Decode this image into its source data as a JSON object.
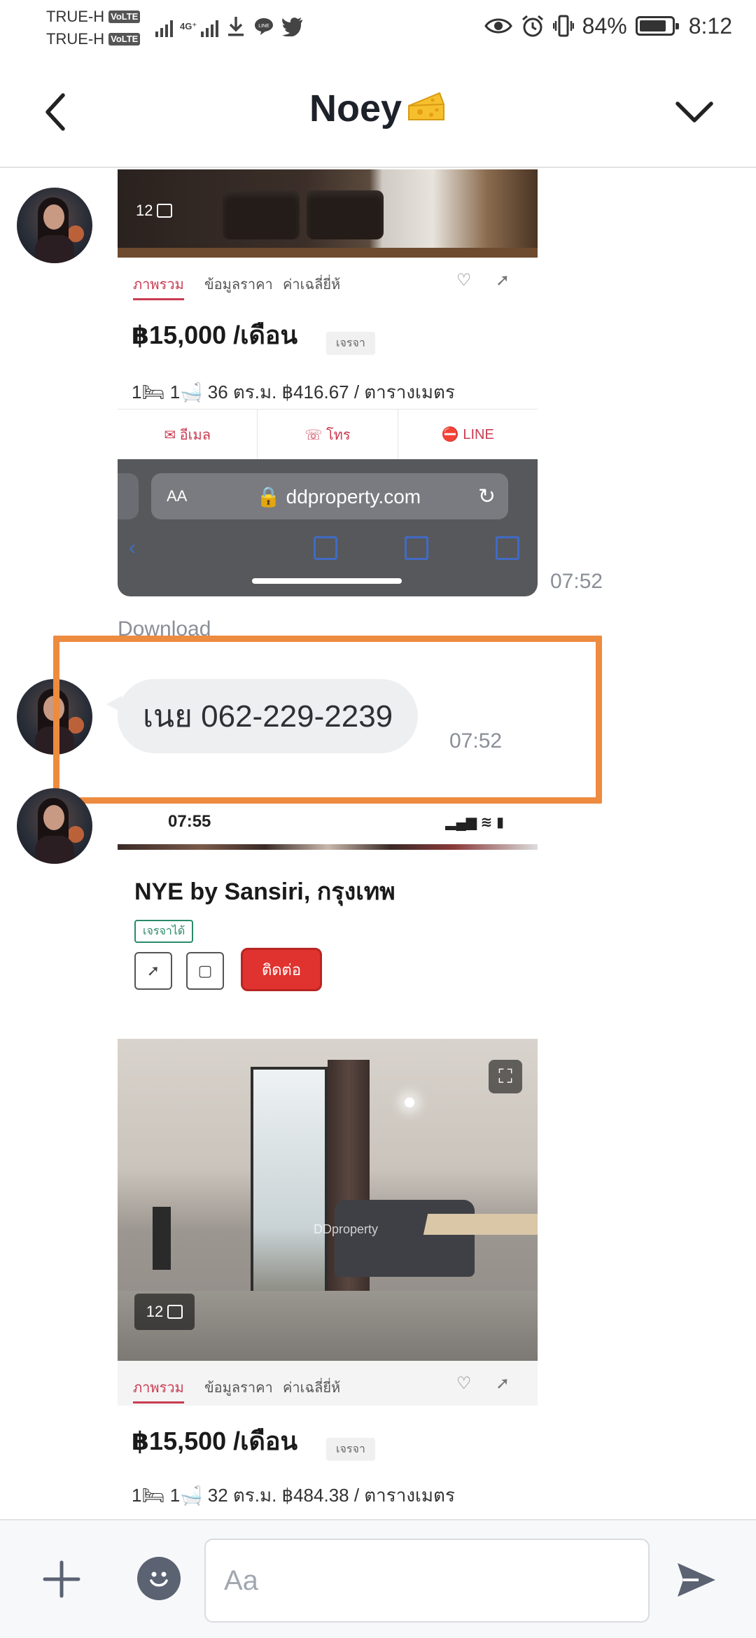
{
  "status_bar": {
    "carrier1": "TRUE-H",
    "carrier2": "TRUE-H",
    "volte_label": "VoLTE",
    "network_label": "4G⁺",
    "battery_percent": "84%",
    "battery_level": 0.84,
    "time": "8:12",
    "icons": [
      "signal-icon",
      "download-icon",
      "line-icon",
      "twitter-icon",
      "eye-icon",
      "alarm-icon",
      "vibrate-icon",
      "battery-icon"
    ]
  },
  "header": {
    "title": "Noey",
    "title_emoji": "🧀",
    "back_icon": "chevron-left-icon",
    "menu_icon": "chevron-down-icon"
  },
  "messages": {
    "image1": {
      "photo_count": "12",
      "tabs": [
        "ภาพรวม",
        "ข้อมูลราคา",
        "ค่าเฉลี่ยี่ห้"
      ],
      "price": "฿15,000 /เดือน",
      "price_tag": "เจรจา",
      "specs": "1🛏  1🛁  36 ตร.ม.  ฿416.67 / ตารางเมตร",
      "actions": [
        "✉ อีเมล",
        "☏ โทร",
        "⛔ LINE"
      ],
      "browser_aa": "AA",
      "browser_url": "🔒 ddproperty.com",
      "browser_reload": "↻",
      "time": "07:52"
    },
    "download_label": "Download",
    "text_message": {
      "text": "เนย 062-229-2239",
      "time": "07:52"
    },
    "image2": {
      "status_time": "07:55",
      "status_right": "▂▄▆ ≋ ▮",
      "title": "NYE by Sansiri, กรุงเทพ",
      "tag": "เจรจาได้",
      "contact_btn": "ติดต่อ",
      "watermark": "DDproperty",
      "photo_count": "12",
      "tabs": [
        "ภาพรวม",
        "ข้อมูลราคา",
        "ค่าเฉลี่ยี่ห้"
      ],
      "price": "฿15,500 /เดือน",
      "price_tag": "เจรจา",
      "specs": "1🛏  1🛁  32 ตร.ม.  ฿484.38 / ตารางเมตร"
    }
  },
  "composer": {
    "placeholder": "Aa"
  },
  "colors": {
    "highlight": "#ed8b3f",
    "bubble": "#eeeff1",
    "accent_red": "#c93c52"
  }
}
